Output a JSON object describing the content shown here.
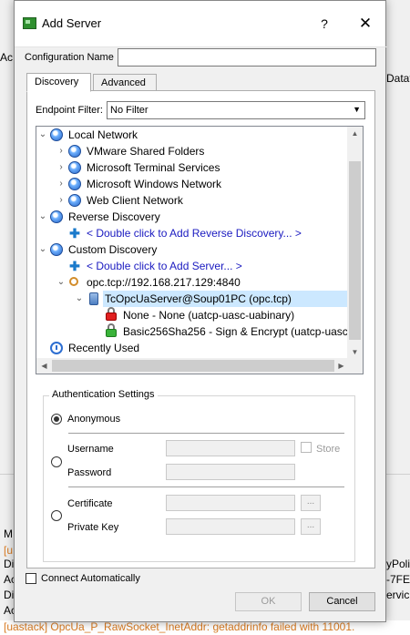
{
  "background": {
    "left_texts": [
      "Ac",
      "M",
      "[u",
      "Di",
      "Ac",
      "Di",
      "Ac"
    ],
    "right_texts": [
      "Datat",
      "yPolic",
      "-7FE1",
      "ervic"
    ],
    "status_line": "[uastack] OpcUa_P_RawSocket_InetAddr: getaddrinfo failed with 11001."
  },
  "dialog": {
    "title": "Add Server",
    "help_label": "?",
    "close_label": "✕",
    "config_name_label": "Configuration Name",
    "config_name_value": "",
    "tabs": [
      {
        "label": "Discovery",
        "active": true
      },
      {
        "label": "Advanced",
        "active": false
      }
    ],
    "endpoint_filter_label": "Endpoint Filter:",
    "endpoint_filter_value": "No Filter",
    "tree": {
      "local_network": "Local Network",
      "vmware": "VMware Shared Folders",
      "ms_terminal": "Microsoft Terminal Services",
      "ms_windows": "Microsoft Windows Network",
      "web_client": "Web Client Network",
      "reverse_discovery": "Reverse Discovery",
      "add_reverse": "< Double click to Add Reverse Discovery... >",
      "custom_discovery": "Custom Discovery",
      "add_server": "< Double click to Add Server... >",
      "opc_url": "opc.tcp://192.168.217.129:4840",
      "server_name": "TcOpcUaServer@Soup01PC (opc.tcp)",
      "endpoint_none": "None - None (uatcp-uasc-uabinary)",
      "endpoint_basic": "Basic256Sha256 - Sign & Encrypt (uatcp-uasc",
      "recently_used": "Recently Used"
    },
    "auth": {
      "group_label": "Authentication Settings",
      "anonymous": "Anonymous",
      "username": "Username",
      "password": "Password",
      "store": "Store",
      "certificate": "Certificate",
      "private_key": "Private Key",
      "browse": "...",
      "selected_mode": "Anonymous"
    },
    "connect_automatically": "Connect Automatically",
    "connect_checked": false,
    "ok_label": "OK",
    "cancel_label": "Cancel"
  }
}
